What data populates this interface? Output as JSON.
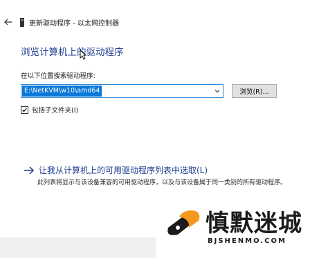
{
  "titlebar": {
    "back_icon": "back-arrow-icon",
    "device_icon": "device-icon",
    "title": "更新驱动程序 - 以太网控制器"
  },
  "main": {
    "heading": "浏览计算机上的驱动程序",
    "search_label": "在以下位置搜索驱动程序:",
    "path_value": "E:\\NetKVM\\w10\\amd64",
    "browse_label": "浏览(R)...",
    "include_subfolders_label": "包括子文件夹(I)",
    "include_subfolders_checked": true,
    "pick_link": "让我从计算机上的可用驱动程序列表中选取(L)",
    "pick_desc": "此列表将显示与该设备兼容的可用驱动程序，以及与该设备属于同一类别的所有驱动程序。"
  },
  "watermark": {
    "text": "慎默迷城",
    "url": "BJSHENMO.COM",
    "accent_orange": "#f39a1e"
  },
  "colors": {
    "heading": "#1e3c91",
    "selection": "#0a78d7",
    "focus_border": "#2f8bd8"
  }
}
